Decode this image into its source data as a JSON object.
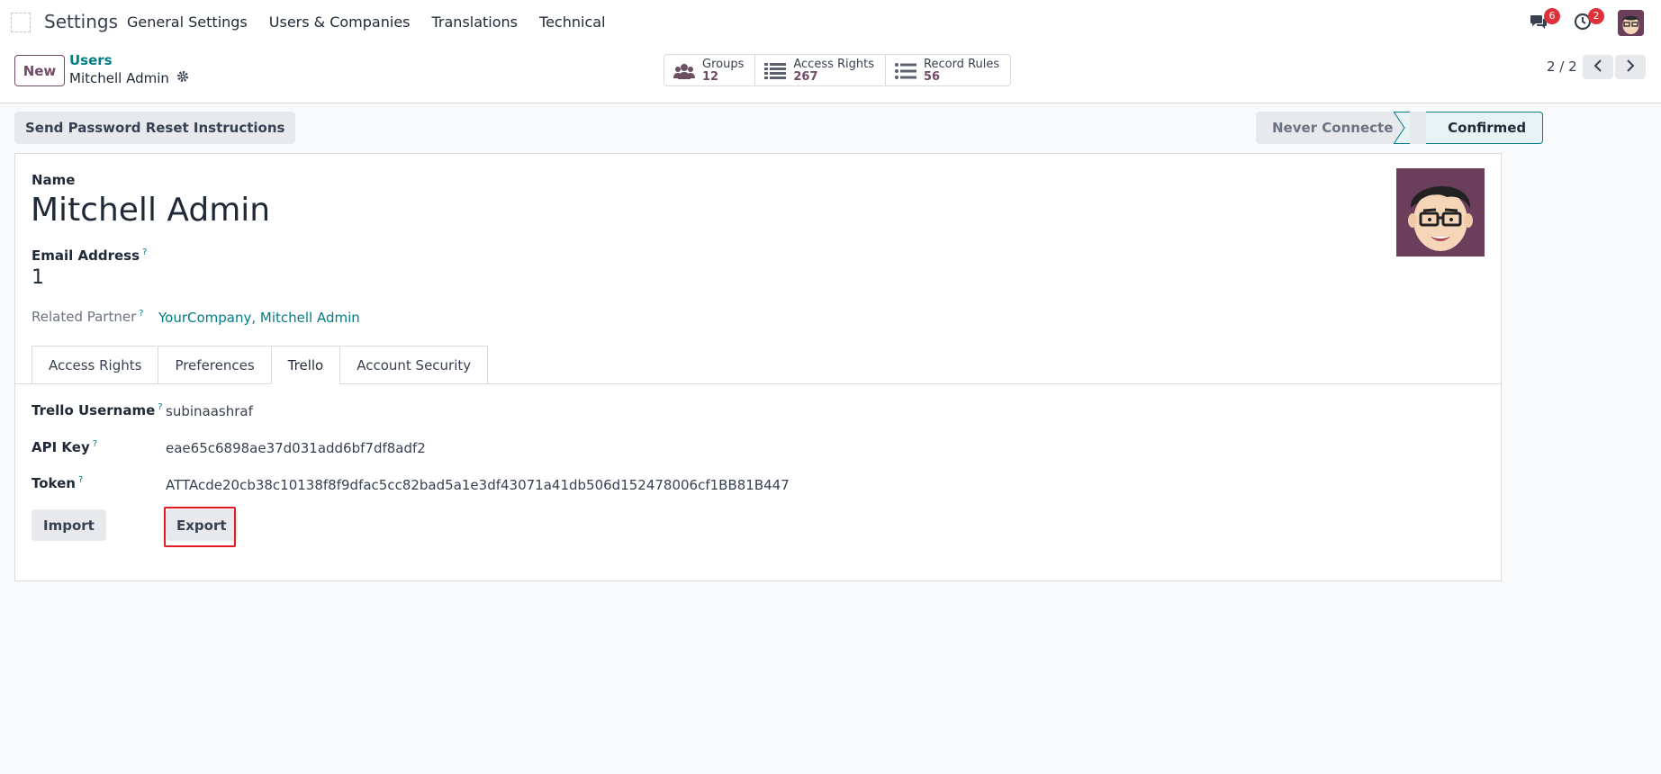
{
  "navbar": {
    "app_name": "Settings",
    "menu": [
      "General Settings",
      "Users & Companies",
      "Translations",
      "Technical"
    ],
    "messages_badge": "6",
    "activities_badge": "2",
    "icons": {
      "messages": "chat-icon",
      "activities": "clock-icon",
      "user": "avatar"
    }
  },
  "control": {
    "new_label": "New",
    "breadcrumb_parent": "Users",
    "breadcrumb_current": "Mitchell Admin",
    "smart_buttons": [
      {
        "label": "Groups",
        "value": "12",
        "icon": "users-icon"
      },
      {
        "label": "Access Rights",
        "value": "267",
        "icon": "list-icon"
      },
      {
        "label": "Record Rules",
        "value": "56",
        "icon": "list-icon"
      }
    ],
    "pager": "2 / 2"
  },
  "status": {
    "reset_button": "Send Password Reset Instructions",
    "stages": [
      "Never Connected",
      "Confirmed"
    ],
    "active_stage": "Confirmed"
  },
  "form": {
    "name_label": "Name",
    "name_value": "Mitchell Admin",
    "email_label": "Email Address",
    "email_value": "1",
    "partner_label": "Related Partner",
    "partner_value": "YourCompany, Mitchell Admin",
    "help_mark": "?"
  },
  "tabs": [
    {
      "label": "Access Rights"
    },
    {
      "label": "Preferences"
    },
    {
      "label": "Trello",
      "active": true
    },
    {
      "label": "Account Security"
    }
  ],
  "trello": {
    "username_label": "Trello Username",
    "username_value": "subinaashraf",
    "api_key_label": "API Key",
    "api_key_value": "eae65c6898ae37d031add6bf7df8adf2",
    "token_label": "Token",
    "token_value": "ATTAcde20cb38c10138f8f9dfac5cc82bad5a1e3df43071a41db506d152478006cf1BB81B447",
    "import_label": "Import",
    "export_label": "Export"
  },
  "colors": {
    "brand": "#714b67",
    "link": "#017e84",
    "highlight": "#e01b24",
    "badge": "#e0313b"
  }
}
